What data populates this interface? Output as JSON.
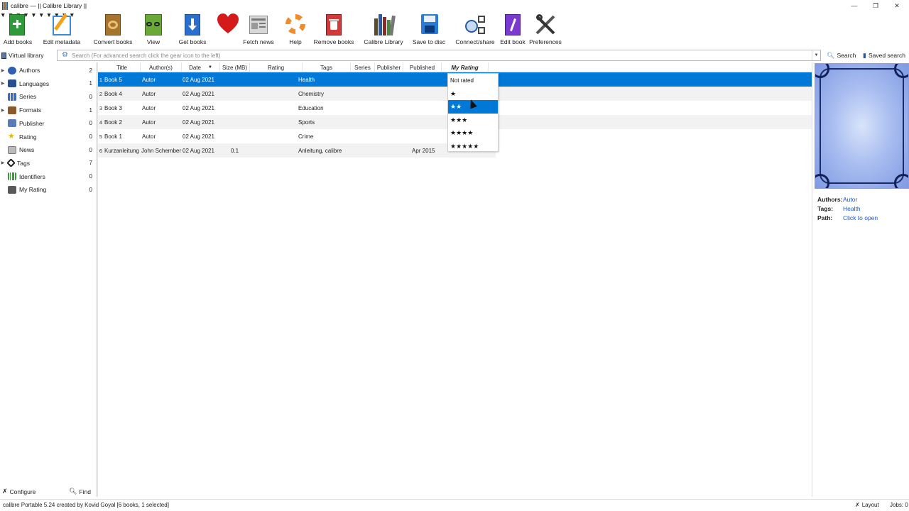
{
  "window": {
    "title": "calibre — || Calibre Library ||",
    "controls": {
      "minimize": "—",
      "maximize": "❐",
      "close": "✕"
    }
  },
  "toolbar": {
    "items": [
      {
        "label": "Add books",
        "icon": "add-books-icon"
      },
      {
        "label": "Edit metadata",
        "icon": "edit-metadata-icon"
      },
      {
        "label": "Convert books",
        "icon": "convert-books-icon"
      },
      {
        "label": "View",
        "icon": "view-icon"
      },
      {
        "label": "Get books",
        "icon": "get-books-icon"
      },
      {
        "label": "",
        "icon": "heart-icon"
      },
      {
        "label": "Fetch news",
        "icon": "fetch-news-icon"
      },
      {
        "label": "Help",
        "icon": "help-icon"
      },
      {
        "label": "Remove books",
        "icon": "remove-books-icon"
      },
      {
        "label": "Calibre Library",
        "icon": "calibre-library-icon"
      },
      {
        "label": "Save to disc",
        "icon": "save-to-disc-icon"
      },
      {
        "label": "Connect/share",
        "icon": "connect-share-icon"
      },
      {
        "label": "Edit book",
        "icon": "edit-book-icon"
      },
      {
        "label": "Preferences",
        "icon": "preferences-icon"
      }
    ]
  },
  "search": {
    "virtual_library": "Virtual library",
    "placeholder": "Search (For advanced search click the gear icon to the left)",
    "search_button": "Search",
    "saved_search_button": "Saved search"
  },
  "tag_browser": {
    "items": [
      {
        "name": "Authors",
        "count": "2",
        "expandable": true,
        "icon": "authors-icon",
        "color": "#2d5fb3"
      },
      {
        "name": "Languages",
        "count": "1",
        "expandable": true,
        "icon": "languages-icon",
        "color": "#2a4f8f"
      },
      {
        "name": "Series",
        "count": "0",
        "expandable": false,
        "icon": "series-icon",
        "color": "#3a6bc2"
      },
      {
        "name": "Formats",
        "count": "1",
        "expandable": true,
        "icon": "formats-icon",
        "color": "#8a5a2a"
      },
      {
        "name": "Publisher",
        "count": "0",
        "expandable": false,
        "icon": "publisher-icon",
        "color": "#5a7ab8"
      },
      {
        "name": "Rating",
        "count": "0",
        "expandable": false,
        "icon": "rating-icon",
        "color": "#e8b800"
      },
      {
        "name": "News",
        "count": "0",
        "expandable": false,
        "icon": "news-icon",
        "color": "#8a8a8a"
      },
      {
        "name": "Tags",
        "count": "7",
        "expandable": true,
        "icon": "tags-icon",
        "color": "#222222"
      },
      {
        "name": "Identifiers",
        "count": "0",
        "expandable": false,
        "icon": "identifiers-icon",
        "color": "#3c9a3c"
      },
      {
        "name": "My Rating",
        "count": "0",
        "expandable": false,
        "icon": "my-rating-icon",
        "color": "#5a5a5a"
      }
    ],
    "configure": "Configure",
    "find": "Find"
  },
  "table": {
    "columns": [
      "Title",
      "Author(s)",
      "Date",
      "Size (MB)",
      "Rating",
      "Tags",
      "Series",
      "Publisher",
      "Published",
      "My Rating"
    ],
    "sort_indicator": "▼",
    "rows": [
      {
        "n": "1",
        "title": "Book 5",
        "author": "Autor",
        "date": "02 Aug 2021",
        "size": "",
        "tags": "Health",
        "published": ""
      },
      {
        "n": "2",
        "title": "Book 4",
        "author": "Autor",
        "date": "02 Aug 2021",
        "size": "",
        "tags": "Chemistry",
        "published": ""
      },
      {
        "n": "3",
        "title": "Book 3",
        "author": "Autor",
        "date": "02 Aug 2021",
        "size": "",
        "tags": "Education",
        "published": ""
      },
      {
        "n": "4",
        "title": "Book 2",
        "author": "Autor",
        "date": "02 Aug 2021",
        "size": "",
        "tags": "Sports",
        "published": ""
      },
      {
        "n": "5",
        "title": "Book 1",
        "author": "Autor",
        "date": "02 Aug 2021",
        "size": "",
        "tags": "Crime",
        "published": ""
      },
      {
        "n": "6",
        "title": "Kurzanleitung",
        "author": "John Schember",
        "date": "02 Aug 2021",
        "size": "0.1",
        "tags": "Anleitung, calibre",
        "published": "Apr 2015"
      }
    ]
  },
  "rating_dropdown": {
    "options": [
      "Not rated",
      "★",
      "★★",
      "★★★",
      "★★★★",
      "★★★★★"
    ],
    "highlighted_index": 2
  },
  "book_details": {
    "authors_label": "Authors:",
    "authors_value": "Autor",
    "tags_label": "Tags:",
    "tags_value": "Health",
    "path_label": "Path:",
    "path_value": "Click to open"
  },
  "statusbar": {
    "text": "calibre Portable 5.24 created by Kovid Goyal   [6 books, 1 selected]",
    "layout": "Layout",
    "jobs": "Jobs: 0"
  }
}
